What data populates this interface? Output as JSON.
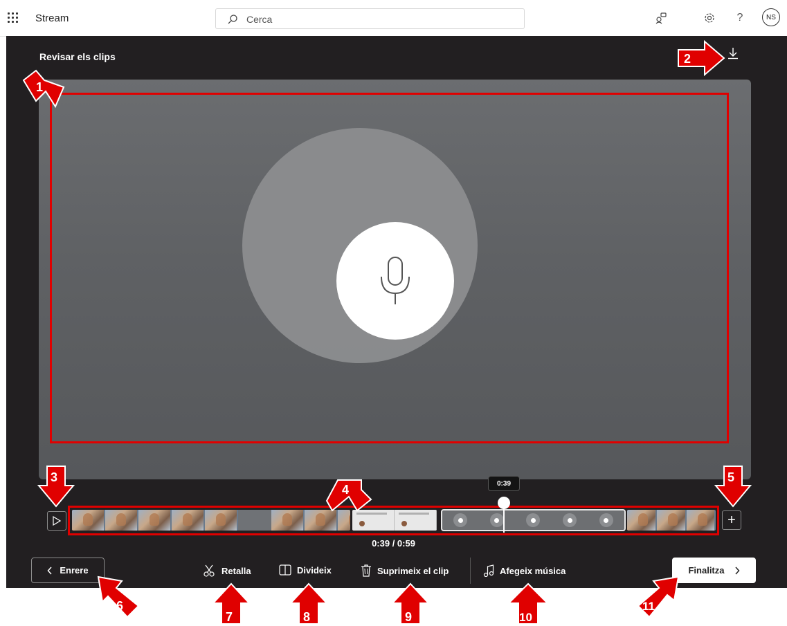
{
  "header": {
    "app_name": "Stream",
    "search_placeholder": "Cerca",
    "avatar_initials": "NS",
    "help_label": "?"
  },
  "editor": {
    "title": "Revisar els clips",
    "playhead_time": "0:39",
    "time_display": "0:39 / 0:59",
    "back_label": "Enrere",
    "finish_label": "Finalitza",
    "tools": [
      {
        "label": "Retalla",
        "icon": "scissors-icon"
      },
      {
        "label": "Divideix",
        "icon": "split-icon"
      },
      {
        "label": "Suprimeix el clip",
        "icon": "trash-icon"
      },
      {
        "label": "Afegeix música",
        "icon": "music-note-icon"
      }
    ],
    "playhead_fraction": 0.661
  },
  "annotations": {
    "color": "#e00000",
    "numbers": [
      "1",
      "2",
      "3",
      "4",
      "5",
      "6",
      "7",
      "8",
      "9",
      "10",
      "11"
    ]
  },
  "colors": {
    "editor_bg": "#221f21",
    "accent_red": "#e00000"
  }
}
